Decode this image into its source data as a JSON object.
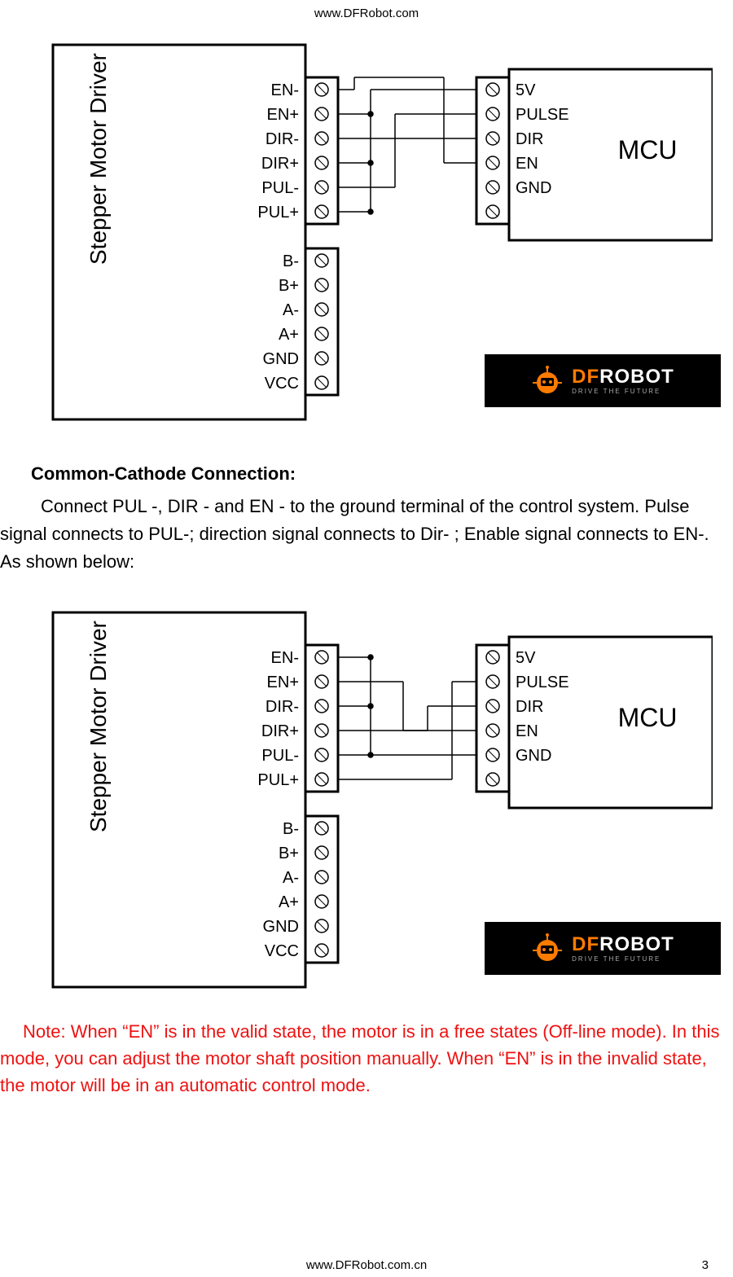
{
  "header_url": "www.DFRobot.com",
  "footer_url": "www.DFRobot.com.cn",
  "page_number": "3",
  "driver_label": "Stepper Motor Driver",
  "mcu_label": "MCU",
  "driver_pins_top": [
    "EN-",
    "EN+",
    "DIR-",
    "DIR+",
    "PUL-",
    "PUL+"
  ],
  "driver_pins_bottom": [
    "B-",
    "B+",
    "A-",
    "A+",
    "GND",
    "VCC"
  ],
  "mcu_pins": [
    "5V",
    "PULSE",
    "DIR",
    "EN",
    "GND",
    ""
  ],
  "section_heading": "Common-Cathode Connection:",
  "body_text": "Connect PUL -, DIR - and EN - to the ground terminal of the control system. Pulse signal connects to PUL-; direction signal connects to Dir- ; Enable signal connects to EN-. As shown below:",
  "note_text": "Note: When “EN” is in the valid state, the motor is in a free states (Off-line mode). In this mode, you can adjust the motor shaft position manually. When “EN” is in the invalid state,  the motor will be in an automatic control mode.",
  "logo_main": "DF",
  "logo_main2": "ROBOT",
  "logo_sub": "DRIVE THE FUTURE"
}
